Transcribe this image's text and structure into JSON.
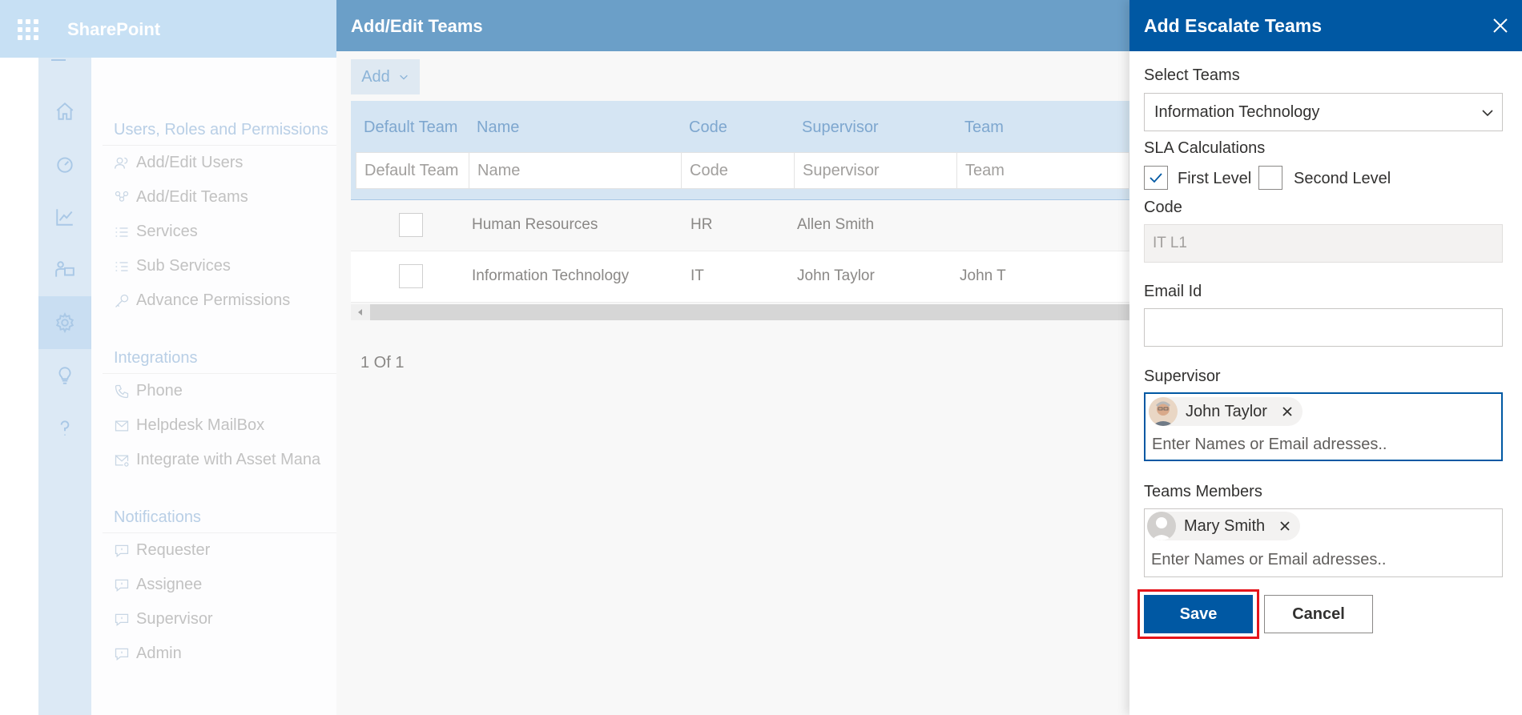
{
  "sharepoint": {
    "brand": "SharePoint",
    "rail_icons": [
      "home-icon",
      "speedometer-icon",
      "chart-icon",
      "people-board-icon",
      "gear-icon",
      "lightbulb-icon",
      "question-icon"
    ],
    "active_rail": "gear-icon"
  },
  "settings_nav": {
    "sections": [
      {
        "title": "Users, Roles and Permissions",
        "items": [
          {
            "label": "Add/Edit Users",
            "icon": "users-icon"
          },
          {
            "label": "Add/Edit Teams",
            "icon": "teams-icon"
          },
          {
            "label": "Services",
            "icon": "list-icon"
          },
          {
            "label": "Sub Services",
            "icon": "sublist-icon"
          },
          {
            "label": "Advance Permissions",
            "icon": "key-icon"
          }
        ]
      },
      {
        "title": "Integrations",
        "items": [
          {
            "label": "Phone",
            "icon": "phone-icon"
          },
          {
            "label": "Helpdesk MailBox",
            "icon": "mail-icon"
          },
          {
            "label": "Integrate with Asset Mana",
            "icon": "mail-settings-icon"
          }
        ]
      },
      {
        "title": "Notifications",
        "items": [
          {
            "label": "Requester",
            "icon": "comment-icon"
          },
          {
            "label": "Assignee",
            "icon": "comment-icon"
          },
          {
            "label": "Supervisor",
            "icon": "comment-icon"
          },
          {
            "label": "Admin",
            "icon": "comment-icon"
          }
        ]
      }
    ]
  },
  "teams_panel": {
    "title": "Add/Edit Teams",
    "add_label": "Add",
    "columns": [
      "Default Team",
      "Name",
      "Code",
      "Supervisor",
      "Team"
    ],
    "filters": [
      "Default Team",
      "Name",
      "Code",
      "Supervisor",
      "Team"
    ],
    "rows": [
      {
        "name": "Human Resources",
        "code": "HR",
        "supervisor": "Allen Smith",
        "team": ""
      },
      {
        "name": "Information Technology",
        "code": "IT",
        "supervisor": "John Taylor",
        "team": "John T"
      }
    ],
    "pager": "1 Of 1"
  },
  "escalate_panel": {
    "title": "Add Escalate Teams",
    "select_teams_label": "Select Teams",
    "select_teams_value": "Information Technology",
    "sla_label": "SLA Calculations",
    "sla_first_label": "First Level",
    "sla_first_checked": true,
    "sla_second_label": "Second Level",
    "sla_second_checked": false,
    "code_label": "Code",
    "code_value": "IT L1",
    "email_label": "Email Id",
    "email_value": "",
    "supervisor_label": "Supervisor",
    "supervisor_chip": "John Taylor",
    "supervisor_placeholder": "Enter Names or Email adresses..",
    "members_label": "Teams Members",
    "members_chip": "Mary Smith",
    "members_placeholder": "Enter Names or Email adresses..",
    "save_label": "Save",
    "cancel_label": "Cancel",
    "accent": "#0058a3",
    "highlight": "#e5141b"
  }
}
